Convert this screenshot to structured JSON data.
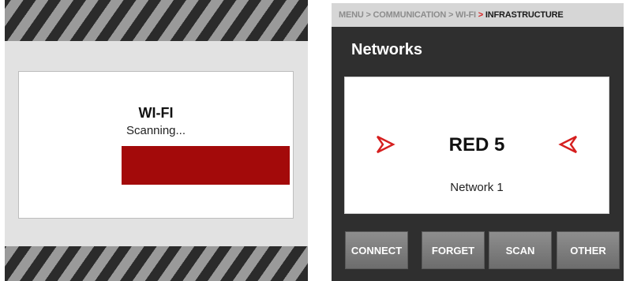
{
  "scan_dialog": {
    "title": "WI-FI",
    "status": "Scanning...",
    "progress_fraction": 0.79,
    "progress_color": "#a30a0a"
  },
  "networks_screen": {
    "breadcrumb": {
      "items": [
        "MENU",
        "COMMUNICATION",
        "WI-FI"
      ],
      "current": "INFRASTRUCTURE",
      "separator": ">"
    },
    "title": "Networks",
    "selected_network": {
      "name": "RED 5",
      "label": "Network 1"
    },
    "prev_icon": "red-arrow-left-icon",
    "next_icon": "red-arrow-right-icon",
    "accent_color": "#d61f1f",
    "buttons": {
      "connect": "CONNECT",
      "forget": "FORGET",
      "scan": "SCAN",
      "other": "OTHER"
    }
  }
}
